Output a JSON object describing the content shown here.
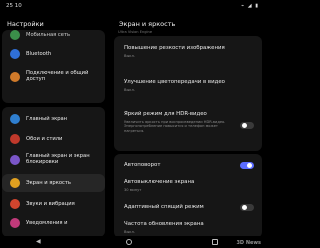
{
  "status": {
    "time": "25 10",
    "icons": "⌁ ◢ ▮"
  },
  "left": {
    "title": "Настройки",
    "items": [
      {
        "label": "Мобильная сеть",
        "color": "#3b8f4a"
      },
      {
        "label": "Bluetooth",
        "color": "#2f6fd6"
      },
      {
        "label": "Подключение и общий доступ",
        "color": "#d07a2a"
      },
      {
        "label": "Главный экран",
        "color": "#2f7fd0"
      },
      {
        "label": "Обои и стили",
        "color": "#c0392b"
      },
      {
        "label": "Главный экран и экран блокировки",
        "color": "#7a56c8"
      },
      {
        "label": "Экран и яркость",
        "color": "#e0a020"
      },
      {
        "label": "Звуки и вибрация",
        "color": "#d0452e"
      },
      {
        "label": "Уведомления и",
        "color": "#c03a7a"
      }
    ]
  },
  "right": {
    "title": "Экран и яркость",
    "top_note": "Ultra Vision Engine",
    "items": [
      {
        "title": "Повышение резкости изображения",
        "sub": "Выкл."
      },
      {
        "title": "Улучшение цветопередачи в видео",
        "sub": "Выкл."
      },
      {
        "title": "Яркий режим для HDR-видео",
        "sub": "Увеличить яркость при воспроизведении HDR-видео. Энергопотребление повысится и телефон может нагреться."
      },
      {
        "title": "Автоповорот",
        "sub": ""
      },
      {
        "title": "Автовыключение экрана",
        "sub": "30 минут"
      },
      {
        "title": "Адаптивный спящий режим",
        "sub": ""
      },
      {
        "title": "Частота обновления экрана",
        "sub": "Выкл."
      }
    ]
  },
  "watermark": "3D News",
  "colors": {
    "accent": "#5b6cff",
    "card": "#161616",
    "toggle_off": "#3a3a3a"
  }
}
